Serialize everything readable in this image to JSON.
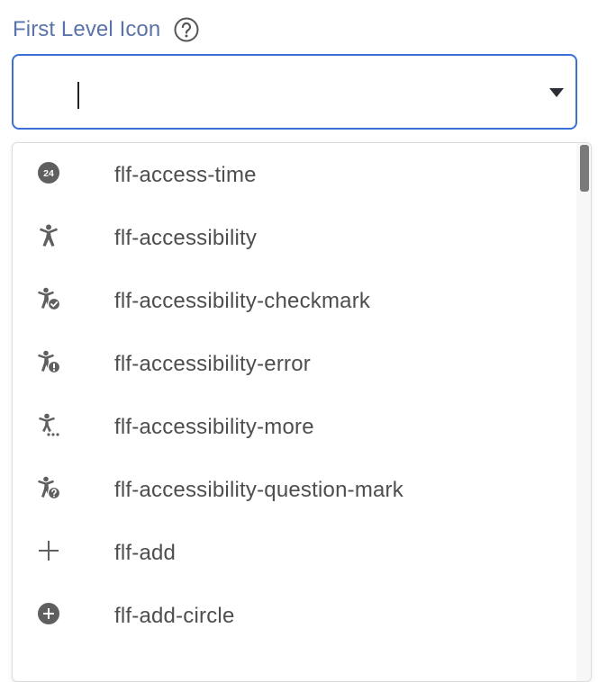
{
  "field": {
    "label": "First Level Icon",
    "help_icon": "question-circle-icon",
    "input_value": "",
    "accent_color": "#3b6fd6",
    "label_color": "#5a73a8"
  },
  "options": [
    {
      "label": "flf-access-time",
      "icon": "access-time-24-icon"
    },
    {
      "label": "flf-accessibility",
      "icon": "accessibility-icon"
    },
    {
      "label": "flf-accessibility-checkmark",
      "icon": "accessibility-checkmark-icon"
    },
    {
      "label": "flf-accessibility-error",
      "icon": "accessibility-error-icon"
    },
    {
      "label": "flf-accessibility-more",
      "icon": "accessibility-more-icon"
    },
    {
      "label": "flf-accessibility-question-mark",
      "icon": "accessibility-question-mark-icon"
    },
    {
      "label": "flf-add",
      "icon": "add-icon"
    },
    {
      "label": "flf-add-circle",
      "icon": "add-circle-icon"
    }
  ]
}
